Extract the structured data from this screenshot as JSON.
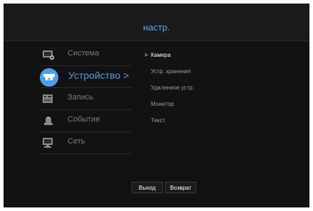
{
  "header": {
    "title": "настр."
  },
  "sidebar": {
    "items": [
      {
        "label": "Система",
        "icon": "system-gear-icon",
        "active": false
      },
      {
        "label": "Устройство >",
        "icon": "camera-device-icon",
        "active": true
      },
      {
        "label": "Запись",
        "icon": "record-icon",
        "active": false
      },
      {
        "label": "Событие",
        "icon": "event-alarm-icon",
        "active": false
      },
      {
        "label": "Сеть",
        "icon": "network-icon",
        "active": false
      }
    ]
  },
  "submenu": {
    "items": [
      {
        "label": "Камера",
        "active": true,
        "marker": ">"
      },
      {
        "label": "Устр. хранения",
        "active": false
      },
      {
        "label": "Удаленное устр.",
        "active": false
      },
      {
        "label": "Монитор",
        "active": false
      },
      {
        "label": "Текст",
        "active": false
      }
    ]
  },
  "buttons": {
    "exit_label": "Выход",
    "back_label": "Возврат"
  },
  "colors": {
    "accent": "#4f9fe6",
    "background": "#121212"
  }
}
